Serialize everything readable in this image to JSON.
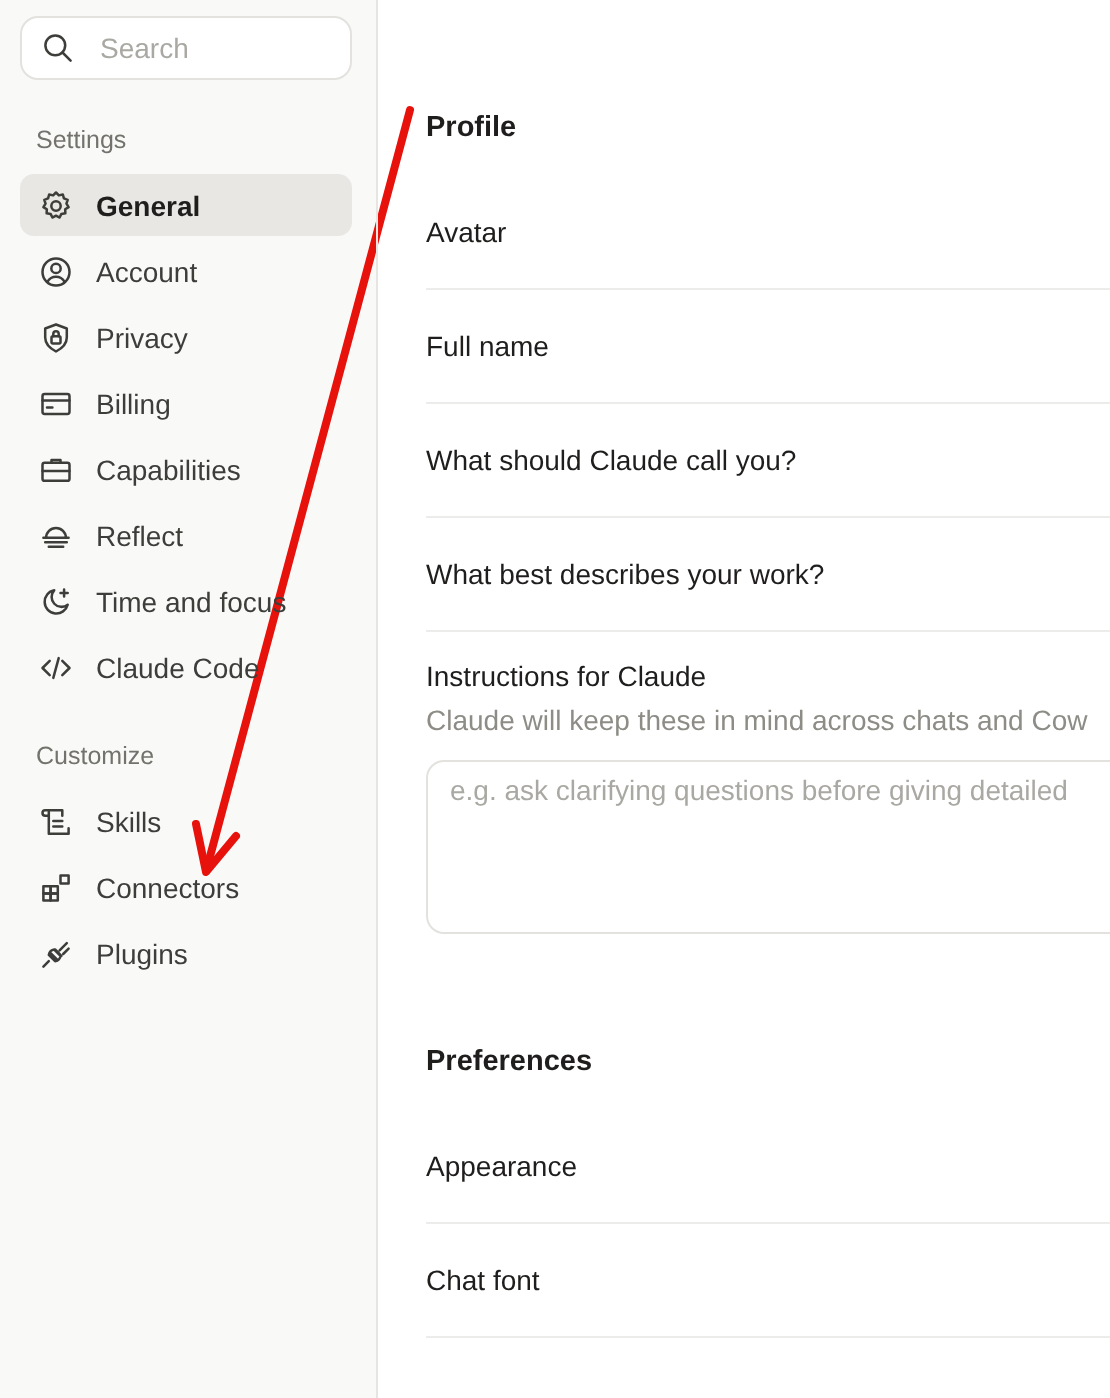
{
  "sidebar": {
    "search": {
      "placeholder": "Search"
    },
    "sections": [
      {
        "title": "Settings",
        "items": [
          {
            "label": "General",
            "selected": true
          },
          {
            "label": "Account",
            "selected": false
          },
          {
            "label": "Privacy",
            "selected": false
          },
          {
            "label": "Billing",
            "selected": false
          },
          {
            "label": "Capabilities",
            "selected": false
          },
          {
            "label": "Reflect",
            "selected": false
          },
          {
            "label": "Time and focus",
            "selected": false
          },
          {
            "label": "Claude Code",
            "selected": false
          }
        ]
      },
      {
        "title": "Customize",
        "items": [
          {
            "label": "Skills",
            "selected": false
          },
          {
            "label": "Connectors",
            "selected": false
          },
          {
            "label": "Plugins",
            "selected": false
          }
        ]
      }
    ]
  },
  "main": {
    "sections": [
      {
        "title": "Profile",
        "rows": [
          {
            "kind": "row",
            "label": "Avatar"
          },
          {
            "kind": "row",
            "label": "Full name"
          },
          {
            "kind": "row",
            "label": "What should Claude call you?"
          },
          {
            "kind": "row",
            "label": "What best describes your work?"
          },
          {
            "kind": "textarea",
            "label": "Instructions for Claude",
            "description": "Claude will keep these in mind across chats and Cow",
            "placeholder": "e.g. ask clarifying questions before giving detailed"
          }
        ]
      },
      {
        "title": "Preferences",
        "rows": [
          {
            "kind": "row",
            "label": "Appearance"
          },
          {
            "kind": "row",
            "label": "Chat font"
          }
        ]
      }
    ]
  }
}
